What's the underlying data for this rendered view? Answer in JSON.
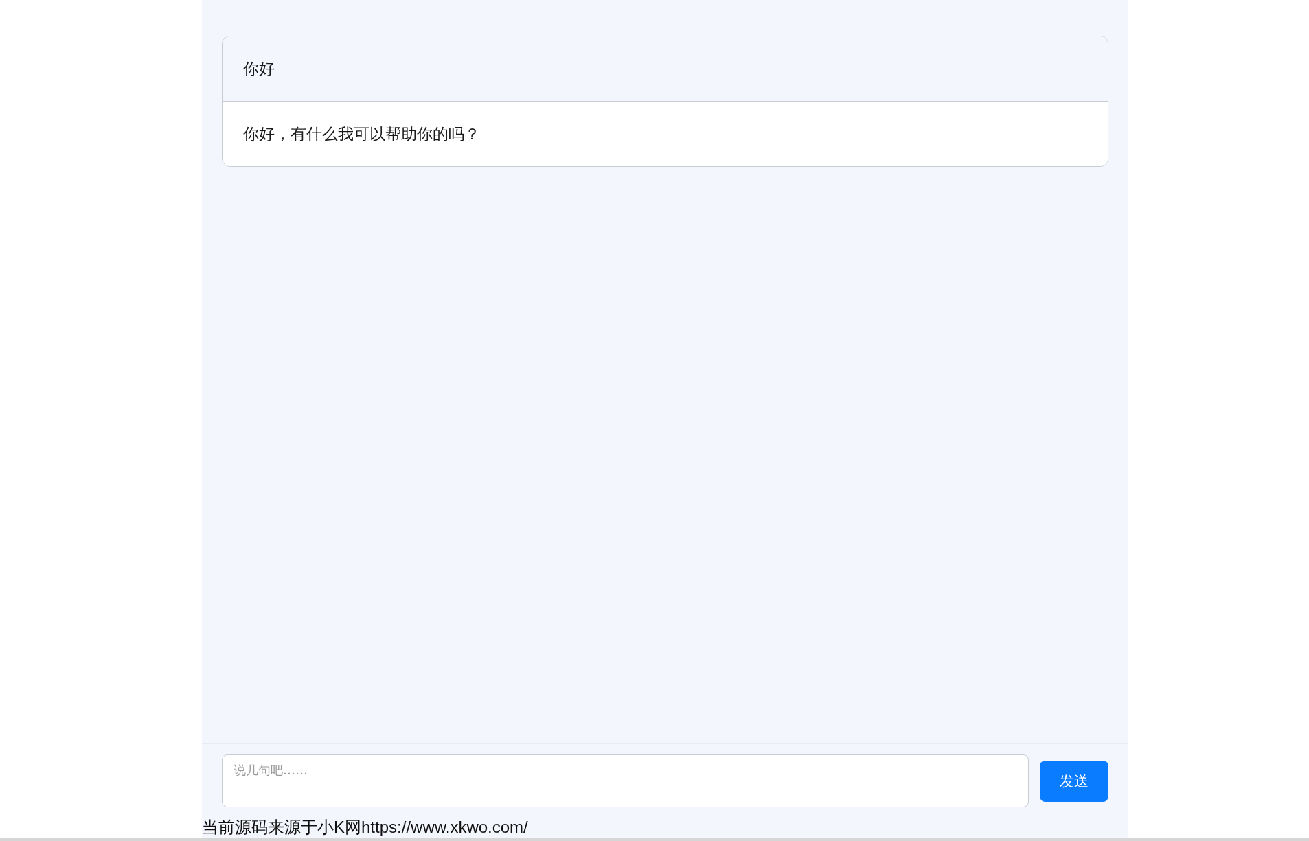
{
  "messages": [
    {
      "kind": "user",
      "text": "你好"
    },
    {
      "kind": "assistant",
      "text": "你好，有什么我可以帮助你的吗？"
    }
  ],
  "composer": {
    "placeholder": "说几句吧……",
    "send_button": "发送"
  },
  "footer": {
    "text": "当前源码来源于小K网https://www.xkwo.com/"
  }
}
